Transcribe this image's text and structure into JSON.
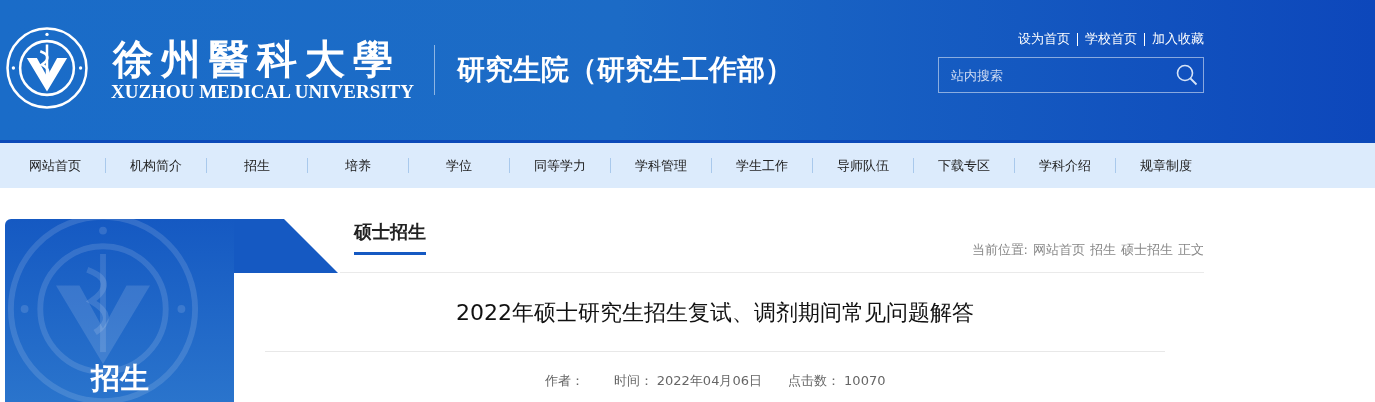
{
  "header": {
    "logo_calligraphy": "徐州醫科大學",
    "logo_english": "XUZHOU MEDICAL UNIVERSITY",
    "site_title": "研究生院（研究生工作部）",
    "top_links": [
      "设为首页",
      "学校首页",
      "加入收藏"
    ],
    "search": {
      "placeholder": "站内搜索"
    }
  },
  "nav": [
    {
      "label": "网站首页"
    },
    {
      "label": "机构简介"
    },
    {
      "label": "招生"
    },
    {
      "label": "培养"
    },
    {
      "label": "学位"
    },
    {
      "label": "同等学力"
    },
    {
      "label": "学科管理"
    },
    {
      "label": "学生工作"
    },
    {
      "label": "导师队伍"
    },
    {
      "label": "下载专区"
    },
    {
      "label": "学科介绍"
    },
    {
      "label": "规章制度"
    }
  ],
  "sidebar": {
    "title": "招生"
  },
  "section": {
    "title": "硕士招生",
    "breadcrumb": {
      "label": "当前位置:",
      "items": [
        "网站首页",
        "招生",
        "硕士招生",
        "正文"
      ]
    }
  },
  "article": {
    "title": "2022年硕士研究生招生复试、调剂期间常见问题解答",
    "meta": [
      {
        "label": "作者："
      },
      {
        "label": "时间：",
        "value": "2022年04月06日"
      },
      {
        "label": "点击数：",
        "value": "10070"
      }
    ]
  }
}
